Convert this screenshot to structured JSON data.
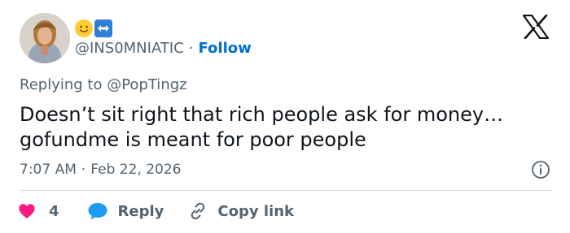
{
  "author": {
    "handle": "@INS0MNIATIC",
    "separator": "·",
    "follow_label": "Follow",
    "emoji": [
      "smiling-face-emoji",
      "left-right-arrow-emoji"
    ]
  },
  "reply_context": {
    "prefix": "Replying to",
    "mention": "@PopTingz"
  },
  "tweet": {
    "line1": "Doesn’t sit right that rich people ask for money…",
    "line2": "gofundme is meant for poor people"
  },
  "meta": {
    "time": "7:07 AM",
    "separator": "·",
    "date": "Feb 22, 2026"
  },
  "actions": {
    "like_count": "4",
    "reply_label": "Reply",
    "copy_label": "Copy link"
  },
  "colors": {
    "like": "#f91880",
    "reply": "#1d9bf0",
    "follow": "#006fd6",
    "muted": "#536471"
  },
  "icons": [
    "x-logo-icon",
    "info-icon",
    "heart-icon",
    "reply-bubble-icon",
    "link-icon"
  ]
}
